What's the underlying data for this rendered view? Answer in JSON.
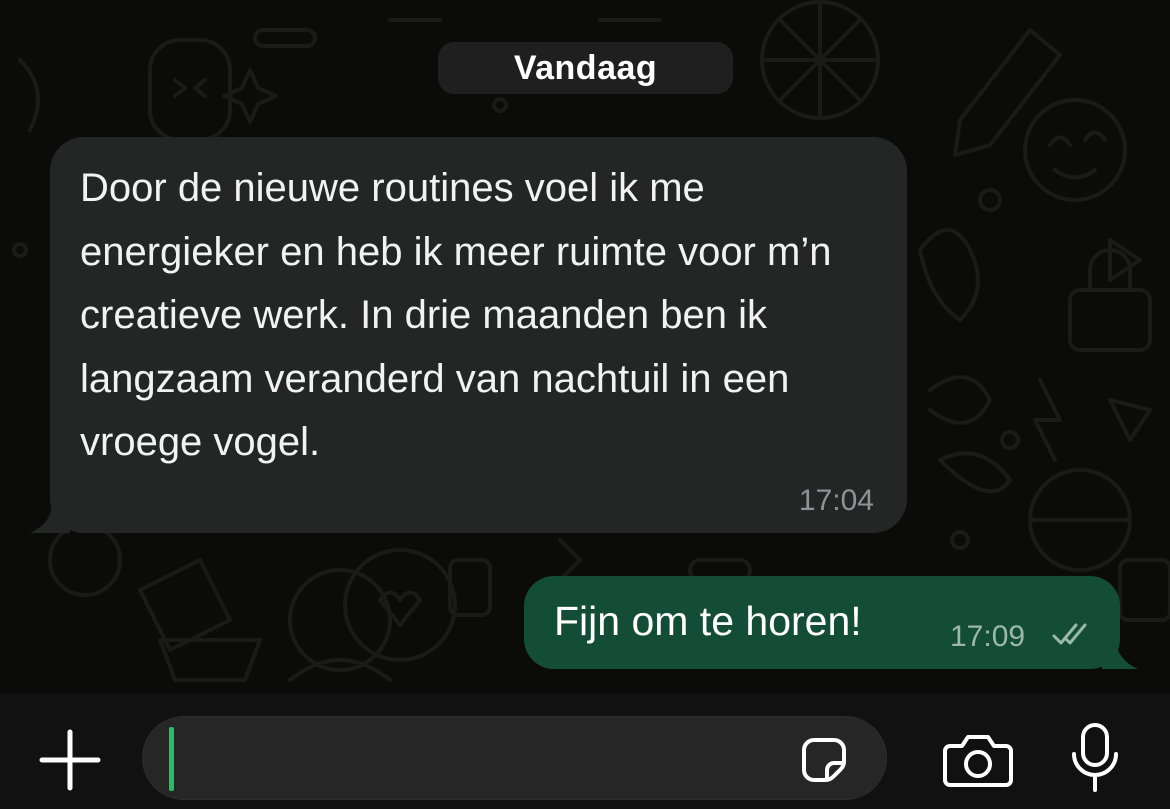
{
  "chat": {
    "date_separator": "Vandaag",
    "messages": [
      {
        "direction": "incoming",
        "text": "Door de nieuwe routines voel ik me energieker en heb ik meer ruimte voor m’n creatieve werk. In drie maanden ben ik langzaam veranderd van nachtuil in een vroege vogel.",
        "time": "17:04"
      },
      {
        "direction": "outgoing",
        "text": "Fijn om te horen!",
        "time": "17:09",
        "status": "read"
      }
    ]
  },
  "composer": {
    "value": "",
    "icons": [
      "plus-icon",
      "sticker-icon",
      "camera-icon",
      "microphone-icon"
    ]
  },
  "colors": {
    "background": "#0b0b0a",
    "incoming_bubble": "#242626",
    "outgoing_bubble": "#134d37",
    "caret": "#21c063"
  }
}
